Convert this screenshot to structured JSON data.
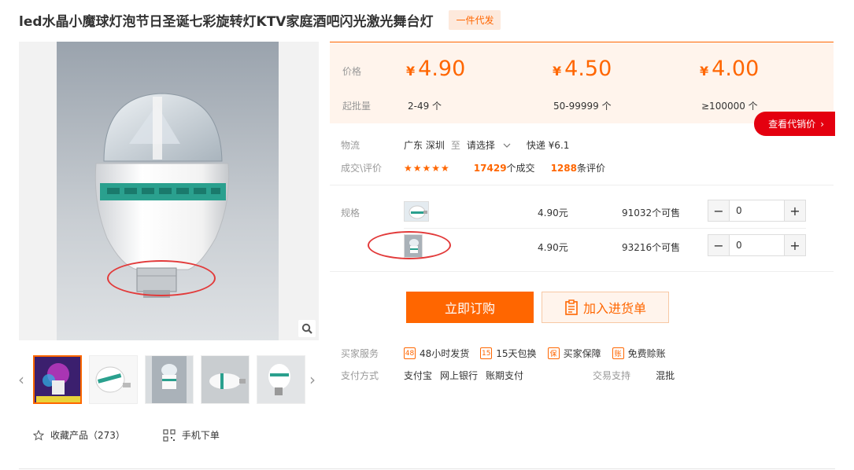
{
  "product": {
    "title": "led水晶小魔球灯泡节日圣诞七彩旋转灯KTV家庭酒吧闪光激光舞台灯",
    "tag": "一件代发"
  },
  "pricing": {
    "price_label": "价格",
    "moq_label": "起批量",
    "currency": "¥",
    "tiers": [
      {
        "price": "4.90",
        "moq": "2-49 个"
      },
      {
        "price": "4.50",
        "moq": "50-99999 个"
      },
      {
        "price": "4.00",
        "moq": "≥100000 个"
      }
    ],
    "agent_price_button": "查看代销价"
  },
  "logistics": {
    "label": "物流",
    "from": "广东 深圳",
    "to_word": "至",
    "destination": "请选择",
    "express": "快递 ¥6.1"
  },
  "deals": {
    "label": "成交\\评价",
    "stars": "★★★★★",
    "orders_count": "17429",
    "orders_suffix": "个成交",
    "reviews_count": "1288",
    "reviews_suffix": "条评价"
  },
  "specs": {
    "label": "规格",
    "items": [
      {
        "price": "4.90元",
        "stock": "91032个可售",
        "qty": "0"
      },
      {
        "price": "4.90元",
        "stock": "93216个可售",
        "qty": "0"
      }
    ]
  },
  "buttons": {
    "buy_now": "立即订购",
    "add_to_list": "加入进货单"
  },
  "services": {
    "label": "买家服务",
    "items": [
      {
        "icon": "48",
        "text": "48小时发货"
      },
      {
        "icon": "15",
        "text": "15天包换"
      },
      {
        "icon": "保",
        "text": "买家保障"
      },
      {
        "icon": "账",
        "text": "免费赊账"
      }
    ]
  },
  "payment": {
    "label": "支付方式",
    "methods": [
      "支付宝",
      "网上银行",
      "账期支付"
    ],
    "trade_support_label": "交易支持",
    "trade_support_value": "混批"
  },
  "bottom": {
    "favorite": "收藏产品（273）",
    "mobile_order": "手机下单"
  },
  "colors": {
    "accent": "#ff6600",
    "price_bg": "#fff4ec",
    "agent_red": "#e4000f",
    "annotation_red": "#e23a3a"
  }
}
